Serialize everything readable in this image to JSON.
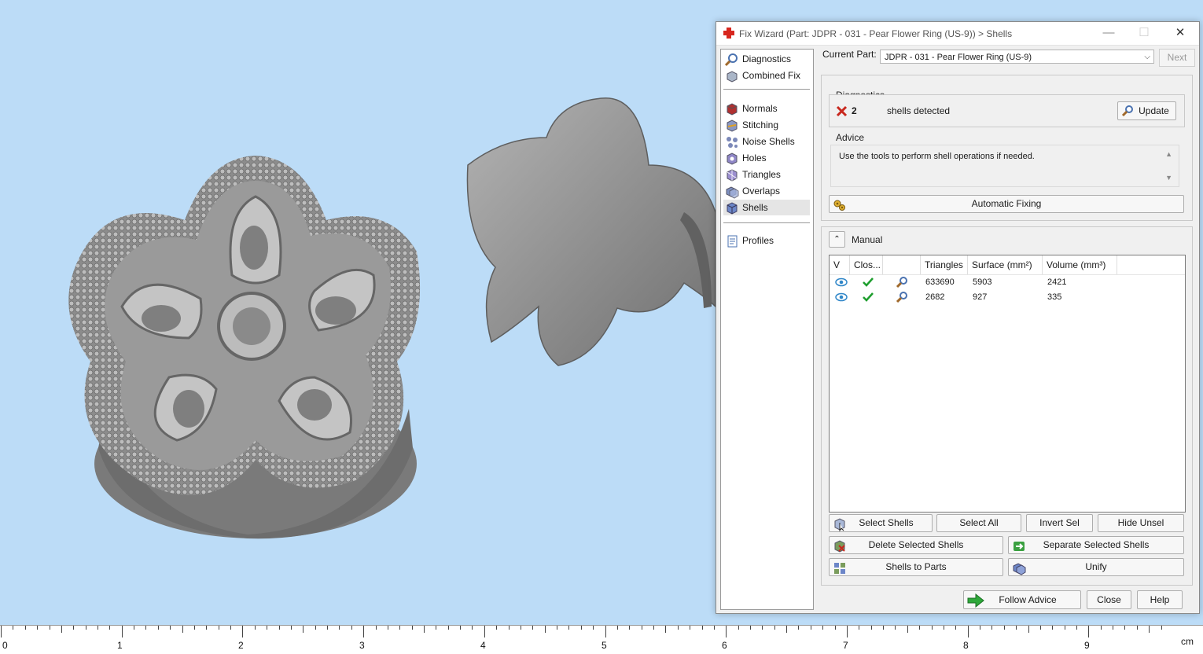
{
  "window": {
    "title": "Fix Wizard (Part: JDPR - 031 - Pear Flower Ring (US-9)) > Shells",
    "minimize": "—",
    "maximize": "☐",
    "close": "✕"
  },
  "nav": {
    "items": [
      {
        "label": "Diagnostics",
        "icon": "diagnostics-icon"
      },
      {
        "label": "Combined Fix",
        "icon": "combined-fix-icon"
      },
      {
        "label": "Normals",
        "icon": "normals-icon"
      },
      {
        "label": "Stitching",
        "icon": "stitching-icon"
      },
      {
        "label": "Noise Shells",
        "icon": "noise-shells-icon"
      },
      {
        "label": "Holes",
        "icon": "holes-icon"
      },
      {
        "label": "Triangles",
        "icon": "triangles-icon"
      },
      {
        "label": "Overlaps",
        "icon": "overlaps-icon"
      },
      {
        "label": "Shells",
        "icon": "shells-icon",
        "selected": true
      },
      {
        "label": "Profiles",
        "icon": "profiles-icon"
      }
    ]
  },
  "current_part": {
    "label": "Current Part:",
    "value": "JDPR - 031 - Pear Flower Ring (US-9)",
    "next": "Next"
  },
  "diagnostics": {
    "title": "Diagnostics",
    "count": "2",
    "message": "shells detected",
    "update": "Update"
  },
  "advice": {
    "title": "Advice",
    "text": "Use the tools to perform shell operations if needed."
  },
  "automatic_fixing": "Automatic Fixing",
  "manual": {
    "title": "Manual",
    "columns": [
      "V",
      "Clos...",
      "",
      "Triangles",
      "Surface (mm²)",
      "Volume (mm³)"
    ],
    "rows": [
      {
        "triangles": "633690",
        "surface": "5903",
        "volume": "2421"
      },
      {
        "triangles": "2682",
        "surface": "927",
        "volume": "335"
      }
    ]
  },
  "buttons": {
    "select_shells": "Select Shells",
    "select_all": "Select All",
    "invert_sel": "Invert Sel",
    "hide_unsel": "Hide Unsel",
    "delete_selected": "Delete Selected Shells",
    "separate_selected": "Separate Selected Shells",
    "shells_to_parts": "Shells to Parts",
    "unify": "Unify",
    "follow_advice": "Follow Advice",
    "close": "Close",
    "help": "Help"
  },
  "ruler": {
    "labels": [
      "0",
      "1",
      "2",
      "3",
      "4",
      "5",
      "6",
      "7",
      "8",
      "9"
    ],
    "unit": "cm"
  }
}
